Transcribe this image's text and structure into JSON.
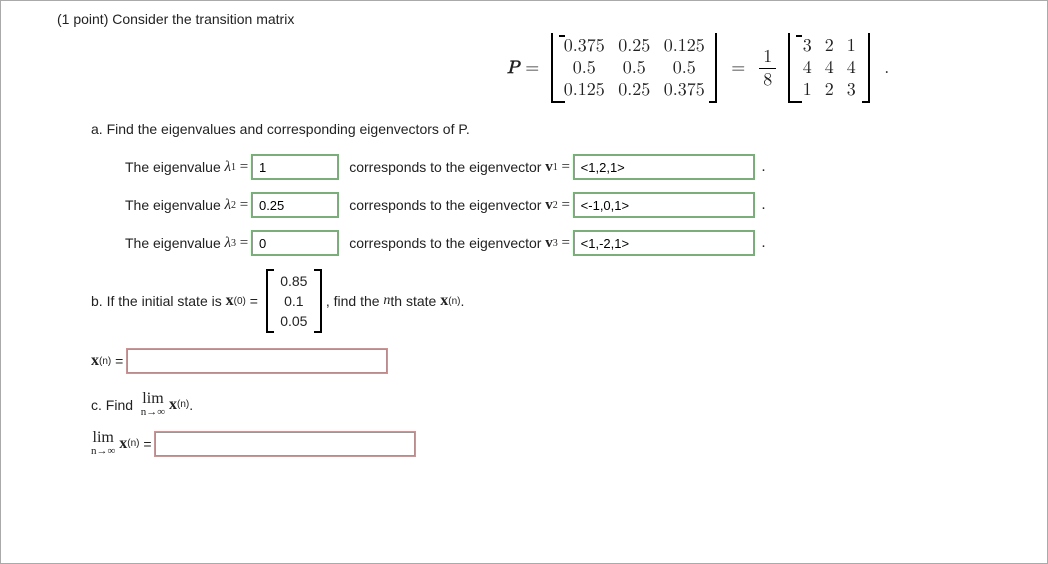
{
  "points_label": "(1 point)",
  "title_text": "Consider the transition matrix",
  "equation": {
    "lhs_var": "P",
    "equals": "=",
    "matrix1": [
      [
        "0.375",
        "0.25",
        "0.125"
      ],
      [
        "0.5",
        "0.5",
        "0.5"
      ],
      [
        "0.125",
        "0.25",
        "0.375"
      ]
    ],
    "frac_num": "1",
    "frac_den": "8",
    "matrix2": [
      [
        "3",
        "2",
        "1"
      ],
      [
        "4",
        "4",
        "4"
      ],
      [
        "1",
        "2",
        "3"
      ]
    ]
  },
  "parts": {
    "a": {
      "heading": "a. Find the eigenvalues and corresponding eigenvectors of P.",
      "pre_lambda": "The eigenvalue",
      "pre_vec": "corresponds to the eigenvector",
      "rows": [
        {
          "lambda_label": "λ₁",
          "lambda_val": "1",
          "vec_label": "v₁",
          "vec_val": "<1,2,1>"
        },
        {
          "lambda_label": "λ₂",
          "lambda_val": "0.25",
          "vec_label": "v₂",
          "vec_val": "<-1,0,1>"
        },
        {
          "lambda_label": "λ₃",
          "lambda_val": "0",
          "vec_label": "v₃",
          "vec_val": "<1,-2,1>"
        }
      ]
    },
    "b": {
      "pre": "b. If the initial state is",
      "x0_sym_base": "x",
      "x0_sup": "(0)",
      "vector": [
        "0.85",
        "0.1",
        "0.05"
      ],
      "mid": ", find the",
      "nth": "n",
      "post": "th state",
      "xn_sup": "(n)",
      "answer_label_base": "x",
      "answer_sup": "(n)"
    },
    "c": {
      "heading_pre": "c. Find",
      "lim_top": "lim",
      "lim_bot": "n→∞",
      "xn_base": "x",
      "xn_sup": "(n)"
    }
  }
}
